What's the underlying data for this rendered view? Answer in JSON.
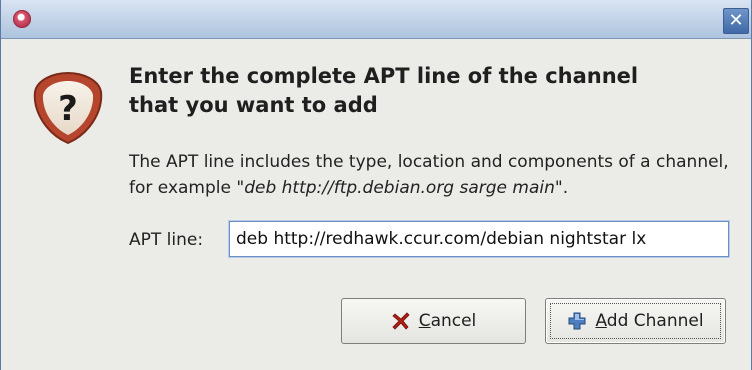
{
  "window": {
    "close_glyph": "✕"
  },
  "dialog": {
    "heading_line1": "Enter the complete APT line of the channel",
    "heading_line2": "that you want to add",
    "description_prefix": "The APT line includes the type, location and components of a channel, for example \"",
    "description_example": "deb http://ftp.debian.org sarge main",
    "description_suffix": "\".",
    "apt_label": "APT line:",
    "apt_value": "deb http://redhawk.ccur.com/debian nightstar lx"
  },
  "buttons": {
    "cancel": {
      "mnemonic": "C",
      "rest": "ancel",
      "icon": "x-icon"
    },
    "add": {
      "mnemonic": "A",
      "rest": "dd Channel",
      "icon": "plus-icon"
    }
  },
  "colors": {
    "titlebar": "#adc3de",
    "dialog_bg": "#ebebe8",
    "input_focus_border": "#6b8fc4",
    "question_icon_red": "#b5452d",
    "cancel_icon": "#b01e14",
    "add_icon": "#4d7fc0"
  }
}
